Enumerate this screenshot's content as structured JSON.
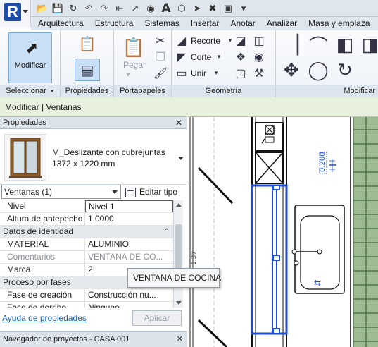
{
  "quick_access": {
    "icons": [
      "open-icon",
      "save-icon",
      "sync-icon",
      "undo-icon",
      "redo-icon",
      "measure-icon",
      "dimension-icon",
      "tag-icon",
      "text-icon",
      "3d-view-icon",
      "section-icon",
      "close-inactive-icon",
      "switch-windows-icon",
      "customize-icon"
    ],
    "text_glyph": "A"
  },
  "tabs": [
    "Arquitectura",
    "Estructura",
    "Sistemas",
    "Insertar",
    "Anotar",
    "Analizar",
    "Masa y emplaza"
  ],
  "ribbon": {
    "seleccionar": {
      "button_label": "Modificar",
      "group_label": "Seleccionar"
    },
    "propiedades": {
      "group_label": "Propiedades"
    },
    "portapapeles": {
      "paste_label": "Pegar",
      "group_label": "Portapapeles"
    },
    "geometria": {
      "items": [
        "Recorte",
        "Corte",
        "Unir"
      ],
      "group_label": "Geometría"
    },
    "modificar": {
      "group_label": "Modificar"
    }
  },
  "options_bar": {
    "context": "Modificar | Ventanas"
  },
  "properties": {
    "title": "Propiedades",
    "type_name": "M_Deslizante con cubrejuntas",
    "type_size": "1372 x 1220 mm",
    "filter": "Ventanas (1)",
    "edit_type": "Editar tipo",
    "rows": [
      {
        "kind": "param",
        "key": "Nivel",
        "value": "Nivel 1",
        "editing": true
      },
      {
        "kind": "param",
        "key": "Altura de antepecho",
        "value": "1.0000"
      },
      {
        "kind": "header",
        "key": "Datos de identidad"
      },
      {
        "kind": "param",
        "key": "MATERIAL",
        "value": "ALUMINIO"
      },
      {
        "kind": "param",
        "key": "Comentarios",
        "value": "VENTANA DE CO...",
        "dim": true
      },
      {
        "kind": "param",
        "key": "Marca",
        "value": "2"
      },
      {
        "kind": "header",
        "key": "Proceso por fases"
      },
      {
        "kind": "param",
        "key": "Fase de creación",
        "value": "Construcción nu..."
      },
      {
        "kind": "param",
        "key": "Fase de derribo",
        "value": "Ninguno"
      }
    ],
    "help_link": "Ayuda de propiedades",
    "apply_button": "Aplicar"
  },
  "project_browser": {
    "title": "Navegador de proyectos - CASA 001"
  },
  "canvas": {
    "dimension_text": "0.200",
    "side_text": "1.37"
  },
  "tooltip": "VENTANA DE COCINA"
}
